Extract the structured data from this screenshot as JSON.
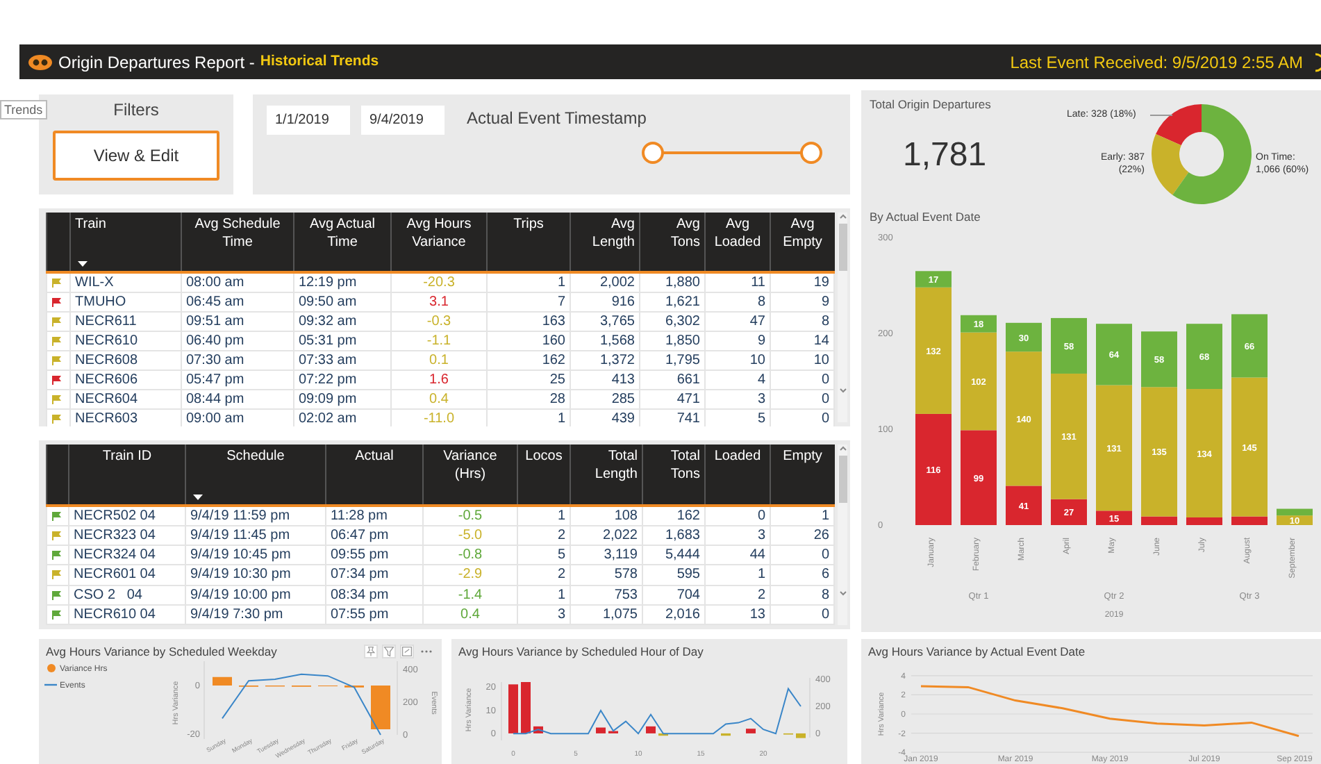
{
  "header": {
    "title": "Origin Departures Report -",
    "subtitle": "Historical Trends",
    "last_event": "Last Event Received: 9/5/2019 2:55 AM"
  },
  "tooltip": "Trends",
  "filters": {
    "title": "Filters",
    "button": "View & Edit"
  },
  "date_filter": {
    "start": "1/1/2019",
    "end": "9/4/2019",
    "title": "Actual Event Timestamp",
    "level": 1
  },
  "trains_table": {
    "columns": [
      {
        "label": "Train",
        "sorted": true
      },
      {
        "label": "Avg Schedule Time",
        "sorted": false
      },
      {
        "label": "Avg Actual Time",
        "sorted": false
      },
      {
        "label": "Avg Hours Variance",
        "sorted": false
      },
      {
        "label": "Trips",
        "sorted": false
      },
      {
        "label": "Avg Length",
        "sorted": false
      },
      {
        "label": "Avg Tons",
        "sorted": false
      },
      {
        "label": "Avg Loaded",
        "sorted": false
      },
      {
        "label": "Avg Empty",
        "sorted": false
      }
    ],
    "rows": [
      {
        "color": "#c9b22a",
        "cells": [
          "WIL-X",
          "08:00 am",
          "12:19 pm",
          "-20.3",
          "1",
          "2,002",
          "1,880",
          "11",
          "19"
        ]
      },
      {
        "color": "#d9262e",
        "cells": [
          "TMUHO",
          "06:45 am",
          "09:50 am",
          "3.1",
          "7",
          "916",
          "1,621",
          "8",
          "9"
        ]
      },
      {
        "color": "#c9b22a",
        "cells": [
          "NECR611",
          "09:51 am",
          "09:32 am",
          "-0.3",
          "163",
          "3,765",
          "6,302",
          "47",
          "8"
        ]
      },
      {
        "color": "#c9b22a",
        "cells": [
          "NECR610",
          "06:40 pm",
          "05:31 pm",
          "-1.1",
          "160",
          "1,568",
          "1,850",
          "9",
          "14"
        ]
      },
      {
        "color": "#c9b22a",
        "cells": [
          "NECR608",
          "07:30 am",
          "07:33 am",
          "0.1",
          "162",
          "1,372",
          "1,795",
          "10",
          "10"
        ]
      },
      {
        "color": "#d9262e",
        "cells": [
          "NECR606",
          "05:47 pm",
          "07:22 pm",
          "1.6",
          "25",
          "413",
          "661",
          "4",
          "0"
        ]
      },
      {
        "color": "#c9b22a",
        "cells": [
          "NECR604",
          "08:44 pm",
          "09:09 pm",
          "0.4",
          "28",
          "285",
          "471",
          "3",
          "0"
        ]
      },
      {
        "color": "#c9b22a",
        "cells": [
          "NECR603",
          "09:00 am",
          "02:02 am",
          "-11.0",
          "1",
          "439",
          "741",
          "5",
          "0"
        ]
      }
    ]
  },
  "recent_table": {
    "columns": [
      {
        "label": "Train ID",
        "sorted": false
      },
      {
        "label": "Schedule",
        "sorted": true
      },
      {
        "label": "Actual",
        "sorted": false
      },
      {
        "label": "Variance (Hrs)",
        "sorted": false
      },
      {
        "label": "Locos",
        "sorted": false
      },
      {
        "label": "Total Length",
        "sorted": false
      },
      {
        "label": "Total Tons",
        "sorted": false
      },
      {
        "label": "Loaded",
        "sorted": false
      },
      {
        "label": "Empty",
        "sorted": false
      }
    ],
    "rows": [
      {
        "color": "#5fa83a",
        "cells": [
          "NECR502 04",
          "9/4/19 11:59 pm",
          "11:28 pm",
          "-0.5",
          "1",
          "108",
          "162",
          "0",
          "1"
        ]
      },
      {
        "color": "#c9b22a",
        "cells": [
          "NECR323 04",
          "9/4/19 11:45 pm",
          "06:47 pm",
          "-5.0",
          "2",
          "2,022",
          "1,683",
          "3",
          "26"
        ]
      },
      {
        "color": "#5fa83a",
        "cells": [
          "NECR324 04",
          "9/4/19 10:45 pm",
          "09:55 pm",
          "-0.8",
          "5",
          "3,119",
          "5,444",
          "44",
          "0"
        ]
      },
      {
        "color": "#c9b22a",
        "cells": [
          "NECR601 04",
          "9/4/19 10:30 pm",
          "07:34 pm",
          "-2.9",
          "2",
          "578",
          "595",
          "1",
          "6"
        ]
      },
      {
        "color": "#5fa83a",
        "cells": [
          "CSO 2   04",
          "9/4/19 10:00 pm",
          "08:34 pm",
          "-1.4",
          "1",
          "753",
          "704",
          "2",
          "8"
        ]
      },
      {
        "color": "#5fa83a",
        "cells": [
          "NECR610 04",
          "9/4/19 7:30 pm",
          "07:55 pm",
          "0.4",
          "3",
          "1,075",
          "2,016",
          "13",
          "0"
        ]
      }
    ]
  },
  "total": {
    "title": "Total Origin Departures",
    "value": "1,781",
    "chart_data": {
      "type": "donut",
      "values": [
        328,
        387,
        1066
      ],
      "colors": [
        "#d9262e",
        "#c9b22a",
        "#6db33f"
      ],
      "value_labels": [
        "Late: 328 (18%)",
        "Early: 387 (22%)",
        "On Time: 1,066 (60%)"
      ]
    }
  },
  "monthly": {
    "title": "By Actual Event Date",
    "groups": [
      "Qtr 1",
      "Qtr 2",
      "Qtr 3"
    ],
    "year": "2019",
    "chart_data": {
      "type": "bar",
      "stacked": true,
      "categories": [
        "January",
        "February",
        "March",
        "April",
        "May",
        "June",
        "July",
        "August",
        "September"
      ],
      "ylim": [
        0,
        300
      ],
      "yticks": [
        0,
        100,
        200,
        300
      ],
      "series": [
        {
          "color": "#d9262e",
          "values": [
            116,
            99,
            41,
            27,
            15,
            9,
            8,
            9,
            0
          ],
          "value_labels": [
            "116",
            "99",
            "41",
            "27",
            "15",
            null,
            null,
            null,
            null
          ]
        },
        {
          "color": "#c9b22a",
          "values": [
            132,
            102,
            140,
            131,
            131,
            135,
            134,
            145,
            10
          ],
          "value_labels": [
            "132",
            "102",
            "140",
            "131",
            "131",
            "135",
            "134",
            "145",
            "10"
          ]
        },
        {
          "color": "#6db33f",
          "values": [
            17,
            18,
            30,
            58,
            64,
            58,
            68,
            66,
            7
          ],
          "value_labels": [
            "17",
            "18",
            "30",
            "58",
            "64",
            "58",
            "68",
            "66",
            null
          ]
        }
      ]
    }
  },
  "weekday": {
    "title": "Avg Hours Variance by Scheduled Weekday",
    "chart_data": {
      "type": "bar",
      "categories": [
        "Sunday",
        "Monday",
        "Tuesday",
        "Wednesday",
        "Thursday",
        "Friday",
        "Saturday"
      ],
      "ylabel": "Hrs Variance",
      "ylim": [
        -22,
        10
      ],
      "yticks": [
        -20,
        0
      ],
      "series": [
        {
          "name": "Variance Hrs",
          "color": "#f08a24",
          "values": [
            3.5,
            -0.5,
            -0.4,
            -0.5,
            -0.3,
            -0.8,
            -18
          ]
        }
      ]
    },
    "events": {
      "chart_data": {
        "type": "line",
        "ylabel": "Events",
        "ylim": [
          0,
          450
        ],
        "yticks": [
          0,
          200,
          400
        ],
        "series": [
          {
            "name": "Events",
            "color": "#3a86c8",
            "values": [
              100,
              330,
              340,
              370,
              360,
              290,
              0
            ]
          }
        ]
      }
    }
  },
  "hourly": {
    "title": "Avg Hours Variance by Scheduled Hour of Day",
    "chart_data": {
      "type": "bar",
      "x": [
        0,
        1,
        2,
        3,
        4,
        5,
        6,
        7,
        8,
        9,
        10,
        11,
        12,
        13,
        14,
        15,
        16,
        17,
        18,
        19,
        20,
        21,
        22,
        23
      ],
      "ylabel": "Hrs Variance",
      "xlim": [
        -0.5,
        23.5
      ],
      "ylim": [
        -3,
        22
      ],
      "yticks": [
        0,
        10,
        20
      ],
      "xticks": [
        0,
        5,
        10,
        15,
        20
      ],
      "series": [
        {
          "color": "#d9262e",
          "values": [
            21,
            22,
            3,
            null,
            null,
            null,
            null,
            2.5,
            1,
            null,
            null,
            3,
            null,
            null,
            null,
            null,
            null,
            null,
            null,
            2,
            null,
            null,
            null,
            null
          ]
        },
        {
          "color": "#c9b22a",
          "values": [
            null,
            null,
            null,
            null,
            null,
            null,
            null,
            null,
            null,
            null,
            null,
            null,
            -1,
            null,
            null,
            null,
            null,
            -1,
            null,
            null,
            null,
            null,
            -0.5,
            -2
          ]
        }
      ]
    },
    "events": {
      "chart_data": {
        "type": "line",
        "ylim": [
          -30,
          410
        ],
        "yticks": [
          0,
          200,
          400
        ],
        "series": [
          {
            "color": "#3a86c8",
            "values": [
              0,
              0,
              30,
              0,
              0,
              0,
              0,
              170,
              20,
              90,
              0,
              140,
              0,
              0,
              0,
              0,
              0,
              70,
              80,
              110,
              30,
              0,
              330,
              200
            ]
          }
        ]
      }
    }
  },
  "by_date": {
    "title": "Avg Hours Variance by Actual Event Date",
    "chart_data": {
      "type": "line",
      "categories": [
        "Jan 2019",
        null,
        "Mar 2019",
        null,
        "May 2019",
        null,
        "Jul 2019",
        null,
        "Sep 2019"
      ],
      "ylabel": "Hrs Variance",
      "grid": true,
      "ylim": [
        -4,
        4
      ],
      "yticks": [
        -4,
        -2,
        0,
        2,
        4
      ],
      "series": [
        {
          "color": "#f08a24",
          "values": [
            2.9,
            2.8,
            1.4,
            0.6,
            -0.5,
            -1.0,
            -1.2,
            -0.9,
            -2.3
          ]
        }
      ]
    }
  }
}
